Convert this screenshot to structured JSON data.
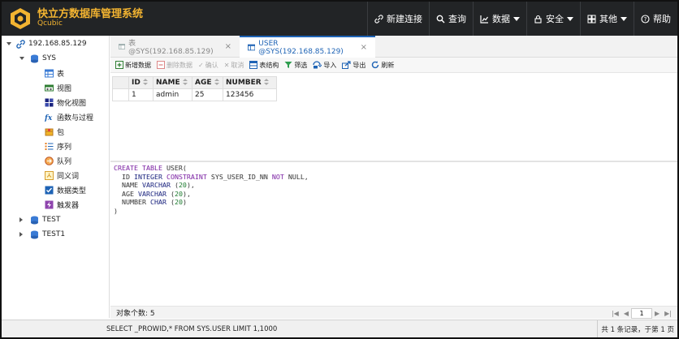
{
  "header": {
    "title": "快立方数据库管理系统",
    "subtitle": "Qcubic",
    "accent": "#f3b431",
    "nav": {
      "new_conn": "新建连接",
      "query": "查询",
      "data": "数据",
      "security": "安全",
      "other": "其他",
      "help": "帮助"
    }
  },
  "sidebar": {
    "server": "192.168.85.129",
    "schema_sys": "SYS",
    "items": [
      "表",
      "视图",
      "物化视图",
      "函数与过程",
      "包",
      "序列",
      "队列",
      "同义词",
      "数据类型",
      "触发器"
    ],
    "schema_test": "TEST",
    "schema_test1": "TEST1"
  },
  "tabs": [
    {
      "label": "表 @SYS(192.168.85.129)",
      "close": "×"
    },
    {
      "label": "USER @SYS(192.168.85.129)",
      "close": "×"
    }
  ],
  "toolbar": {
    "add": "新增数据",
    "delete": "删除数据",
    "confirm": "确认",
    "cancel": "取消",
    "structure": "表结构",
    "filter": "筛选",
    "import": "导入",
    "export": "导出",
    "refresh": "刷新"
  },
  "grid": {
    "columns": [
      "ID",
      "NAME",
      "AGE",
      "NUMBER"
    ],
    "rows": [
      [
        "1",
        "admin",
        "25",
        "123456"
      ]
    ]
  },
  "sql": {
    "l1a": "CREATE TABLE ",
    "l1b": "USER(",
    "l2a": "  ID ",
    "l2b": "INTEGER ",
    "l2c": "CONSTRAINT ",
    "l2d": "SYS_USER_ID_NN ",
    "l2e": "NOT ",
    "l2f": "NULL,",
    "l3a": "  NAME ",
    "l3b": "VARCHAR ",
    "l3c": "(",
    "l3d": "20",
    "l3e": "),",
    "l4a": "  AGE ",
    "l4b": "VARCHAR ",
    "l4c": "(",
    "l4d": "20",
    "l4e": "),",
    "l5a": "  NUMBER ",
    "l5b": "CHAR ",
    "l5c": "(",
    "l5d": "20",
    "l5e": ")",
    "l6": ")"
  },
  "footer": {
    "object_count": "对象个数: 5",
    "page": "1"
  },
  "status": {
    "query": "SELECT _PROWID,* FROM SYS.USER LIMIT 1,1000",
    "info": "共 1 条记录，于第 1 页"
  }
}
